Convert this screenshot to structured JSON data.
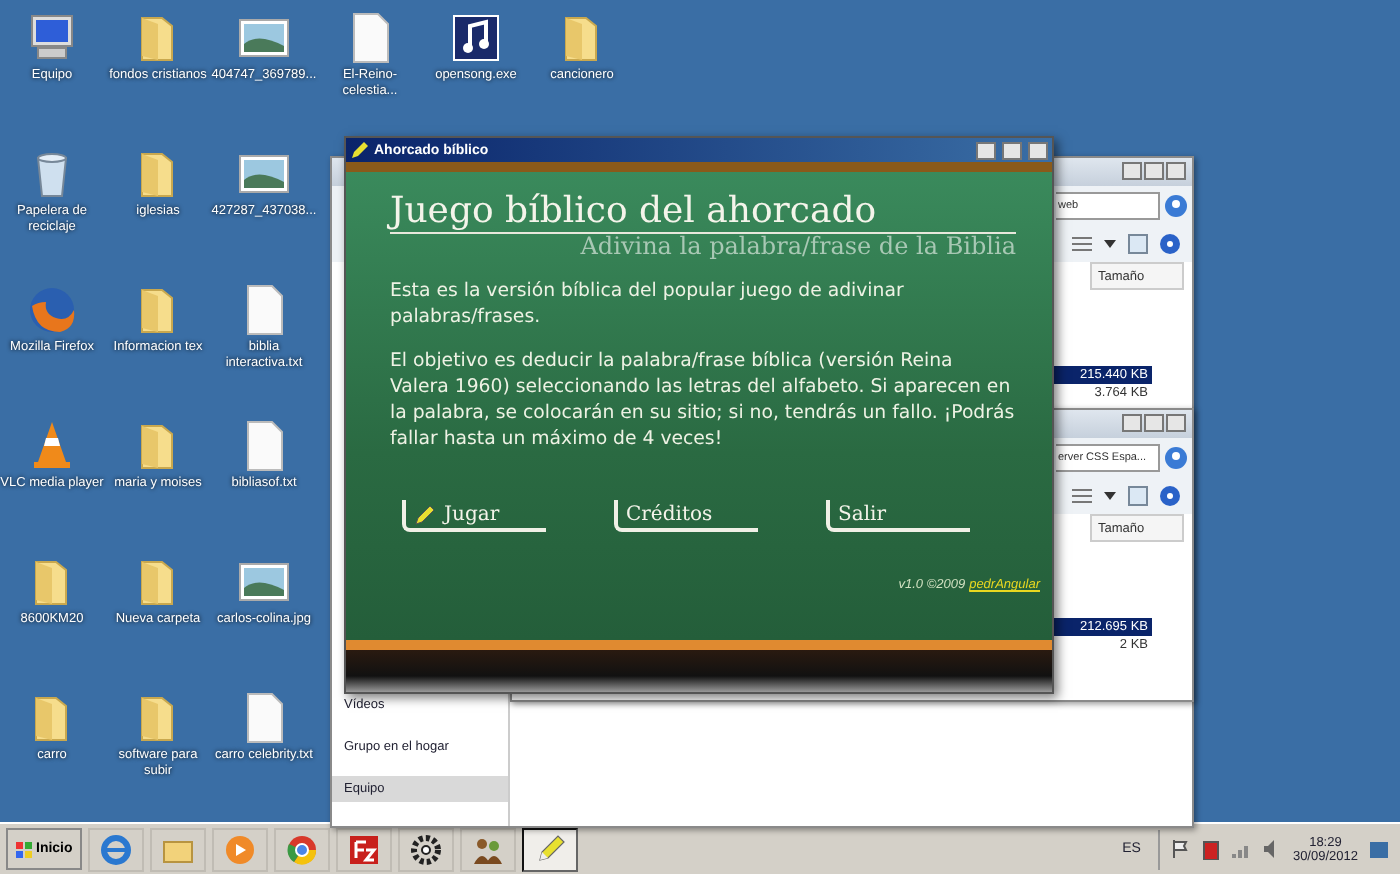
{
  "desktop": {
    "rows": [
      [
        {
          "kind": "computer",
          "label": "Equipo"
        },
        {
          "kind": "folder",
          "label": "fondos cristianos"
        },
        {
          "kind": "image",
          "label": "404747_369789..."
        },
        {
          "kind": "document",
          "label": "El-Reino-celestia..."
        },
        {
          "kind": "exe",
          "label": "opensong.exe"
        },
        {
          "kind": "folder",
          "label": "cancionero"
        }
      ],
      [
        {
          "kind": "recycle",
          "label": "Papelera de reciclaje"
        },
        {
          "kind": "folder",
          "label": "iglesias"
        },
        {
          "kind": "image",
          "label": "427287_437038..."
        }
      ],
      [
        {
          "kind": "firefox",
          "label": "Mozilla Firefox"
        },
        {
          "kind": "folder",
          "label": "Informacion tex"
        },
        {
          "kind": "document",
          "label": "biblia interactiva.txt"
        }
      ],
      [
        {
          "kind": "vlc",
          "label": "VLC media player"
        },
        {
          "kind": "folder",
          "label": "maria y moises"
        },
        {
          "kind": "document",
          "label": "bibliasof.txt"
        }
      ],
      [
        {
          "kind": "folder",
          "label": "8600KM20"
        },
        {
          "kind": "folder",
          "label": "Nueva carpeta"
        },
        {
          "kind": "image",
          "label": "carlos-colina.jpg"
        }
      ],
      [
        {
          "kind": "folder",
          "label": "carro"
        },
        {
          "kind": "folder",
          "label": "software para subir"
        },
        {
          "kind": "document",
          "label": "carro celebrity.txt"
        }
      ]
    ]
  },
  "explorer_back": {
    "search": "web",
    "column_header": "Tamaño",
    "rows": [
      {
        "size": "215.440 KB",
        "selected": true
      },
      {
        "size": "3.764 KB",
        "selected": false
      }
    ],
    "nav_items": [
      {
        "label": "Vídeos",
        "selected": false
      },
      {
        "label": "Grupo en el hogar",
        "selected": false
      },
      {
        "label": "Equipo",
        "selected": true
      }
    ]
  },
  "explorer_front": {
    "search": "erver CSS Espa...",
    "column_header": "Tamaño",
    "rows": [
      {
        "size": "212.695 KB",
        "selected": true
      },
      {
        "size": "2 KB",
        "selected": false
      }
    ]
  },
  "game_window": {
    "title": "Ahorcado bíblico",
    "heading": "Juego bíblico del ahorcado",
    "subheading": "Adivina la palabra/frase de la Biblia",
    "paragraphs": [
      "Esta es la versión bíblica del popular juego de adivinar palabras/frases.",
      "El objetivo es deducir la palabra/frase bíblica (versión Reina Valera 1960) seleccionando las letras del alfabeto. Si aparecen en la palabra, se colocarán en su sitio; si no, tendrás un fallo. ¡Podrás fallar hasta un máximo de 4 veces!"
    ],
    "menu": [
      {
        "label": "Jugar",
        "selected": true
      },
      {
        "label": "Créditos",
        "selected": false
      },
      {
        "label": "Salir",
        "selected": false
      }
    ],
    "version": "v1.0 ©2009",
    "author": "pedrAngular"
  },
  "taskbar": {
    "start": "Inicio",
    "apps": [
      {
        "kind": "browser",
        "active": false
      },
      {
        "kind": "folder",
        "active": false
      },
      {
        "kind": "media",
        "active": false
      },
      {
        "kind": "globe",
        "active": false
      },
      {
        "kind": "ftp",
        "active": false
      },
      {
        "kind": "gear",
        "active": false
      },
      {
        "kind": "people",
        "active": false
      },
      {
        "kind": "pencil",
        "active": true
      }
    ],
    "language": "ES",
    "time": "18:29",
    "date": "30/09/2012"
  }
}
